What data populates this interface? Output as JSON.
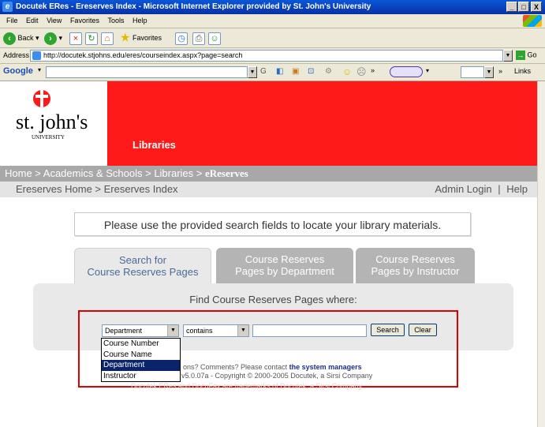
{
  "window": {
    "title": "Docutek ERes - Ereserves Index - Microsoft Internet Explorer provided by St. John's University",
    "controls": [
      "_",
      "□",
      "X"
    ]
  },
  "menu": [
    "File",
    "Edit",
    "View",
    "Favorites",
    "Tools",
    "Help"
  ],
  "toolbar": {
    "back": "Back",
    "favorites": "Favorites"
  },
  "address": {
    "label": "Address",
    "url": "http://docutek.stjohns.edu/eres/courseindex.aspx?page=search",
    "go": "Go"
  },
  "google_bar": {
    "logo": "Google",
    "links": "Links"
  },
  "site": {
    "logo_text": "st. john's",
    "logo_sub": "UNIVERSITY",
    "section": "Libraries",
    "breadcrumb": {
      "prefix": "Home > Academics & Schools > Libraries > ",
      "current": "eReserves"
    },
    "subnav": {
      "left": "Ereserves Home > Ereserves Index",
      "admin": "Admin Login",
      "sep": "|",
      "help": "Help"
    }
  },
  "notice": "Please use the provided search fields to locate your library materials.",
  "tabs": [
    {
      "line1": "Search for",
      "line2": "Course Reserves Pages"
    },
    {
      "line1": "Course Reserves",
      "line2": "Pages by Department"
    },
    {
      "line1": "Course Reserves",
      "line2": "Pages by Instructor"
    }
  ],
  "search": {
    "heading": "Find Course Reserves Pages where:",
    "field_selected": "Department",
    "operator_selected": "contains",
    "query_value": "",
    "search_button": "Search",
    "clear_button": "Clear",
    "field_options": [
      "Course Number",
      "Course Name",
      "Department",
      "Instructor"
    ]
  },
  "footer": {
    "line1_pre": "ons? Comments? Please contact ",
    "line1_link": "the system managers",
    "line2": "v5.0.07a - Copyright © 2000-2005 Docutek, a Sirsi Company",
    "line3": "Docutek ERes and DocuFax are trademarks of Docutek, a Sirsi Company"
  },
  "colors": {
    "banner_red": "#ff1a1a",
    "highlight_border": "#e00000",
    "tab_active_text": "#4a6b98",
    "xp_blue": "#0a56d6"
  }
}
